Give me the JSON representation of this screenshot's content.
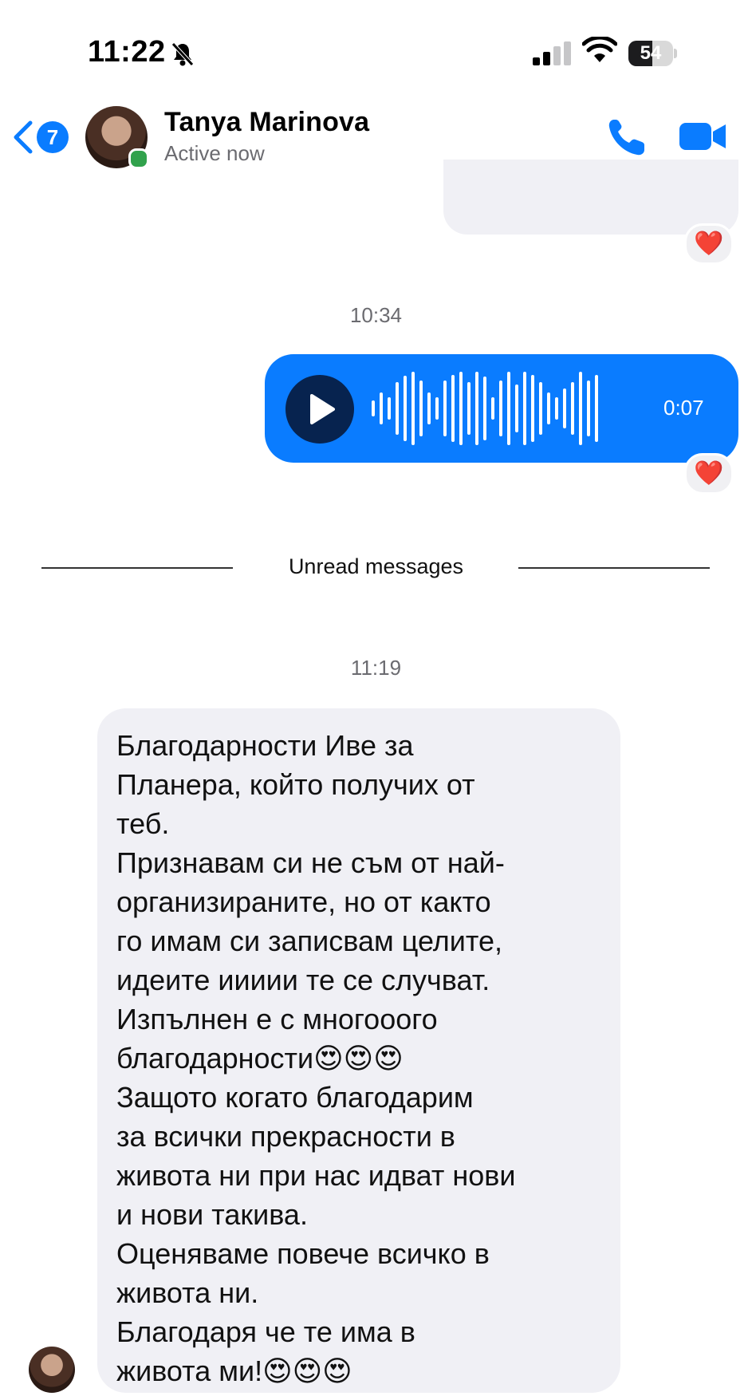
{
  "status_bar": {
    "time": "11:22",
    "battery": "54",
    "battery_level": 0.54,
    "icons": [
      "bell-slash-icon",
      "signal-icon",
      "wifi-icon",
      "battery-icon"
    ]
  },
  "header": {
    "back_count": "7",
    "contact_name": "Tanya Marinova",
    "contact_status": "Active now",
    "icons": [
      "back-chevron-icon",
      "phone-icon",
      "video-camera-icon"
    ],
    "accent_color": "#0a7cff",
    "online_color": "#31a24c"
  },
  "conversation": {
    "reaction_1": "❤️",
    "timestamp_1": "10:34",
    "voice_message": {
      "duration": "0:07",
      "bubble_color": "#0a7cff",
      "icon": "play-icon"
    },
    "reaction_2": "❤️",
    "unread_label": "Unread messages",
    "timestamp_2": "11:19",
    "incoming_message": "Благодарности Иве за\nПланера, който получих от\nтеб.\nПризнавам си не съм от най-\nорганизираните, но от както\nго имам си записвам целите,\nидеите иииии те се случват.\nИзпълнен е с многооого\nблагодарности😍😍😍\nЗащото когато благодарим\nза всички прекрасности в\nживота ни при нас идват нови\nи нови такива.\nОценяваме повече всичко в\nживота ни.\nБлагодаря че те има в\nживота ми!😍😍😍",
    "bubble_color": "#f0f0f5"
  }
}
